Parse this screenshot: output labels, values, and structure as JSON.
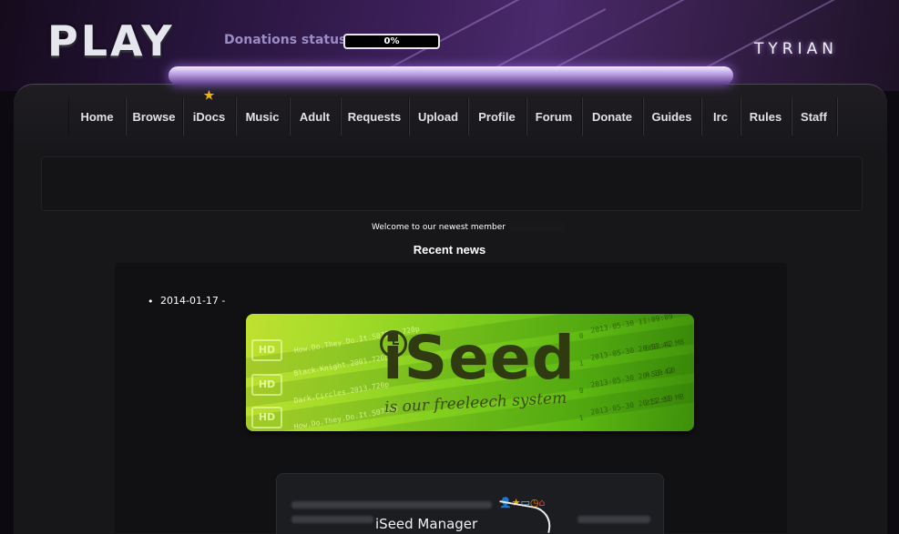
{
  "header": {
    "logo_text": "PLAY",
    "donations_label": "Donations status:",
    "donations_percent": "0%",
    "donations_progress": 0,
    "theme_name": "TYRIAN",
    "accent_color": "#7a4fb0"
  },
  "nav": {
    "items": [
      {
        "label": "Home"
      },
      {
        "label": "Browse"
      },
      {
        "label": "iDocs",
        "icon": "star-icon"
      },
      {
        "label": "Music"
      },
      {
        "label": "Adult"
      },
      {
        "label": "Requests"
      },
      {
        "label": "Upload"
      },
      {
        "label": "Profile"
      },
      {
        "label": "Forum"
      },
      {
        "label": "Donate"
      },
      {
        "label": "Guides"
      },
      {
        "label": "Irc"
      },
      {
        "label": "Rules"
      },
      {
        "label": "Staff"
      }
    ]
  },
  "welcome": {
    "text": "Welcome to our newest member"
  },
  "news": {
    "title": "Recent news",
    "items": [
      {
        "date_line": "2014-01-17 -"
      }
    ]
  },
  "iseed_banner": {
    "title": "iSeed",
    "tagline": "is our freeleech system",
    "row_texts": [
      "How.Do.They.Do.It.S07E10.720p",
      "Black.Knight.2001.720p",
      "Dark.Circles.2013.720p",
      "How.Do.They.Do.It.S07E10"
    ],
    "badge": "HD",
    "date_rows": [
      "2013-05-30 11:09:09",
      "2013-05-30 20:53:42",
      "2013-05-30 20:53:42",
      "2013-05-30 20:52:59"
    ],
    "size_rows": [
      "668.41 MB",
      "4.19 GB",
      "211.01 MB"
    ],
    "count_rows": [
      "0",
      "1",
      "0",
      "1"
    ]
  },
  "manager_panel": {
    "label": "iSeed Manager"
  }
}
